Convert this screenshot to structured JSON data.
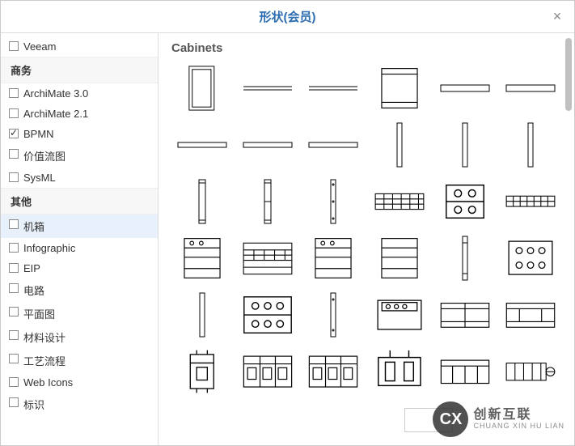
{
  "dialog": {
    "title": "形状(会员)"
  },
  "sidebar": {
    "top_item": {
      "label": "Veeam",
      "checked": false
    },
    "groups": [
      {
        "header": "商务",
        "items": [
          {
            "label": "ArchiMate 3.0",
            "checked": false
          },
          {
            "label": "ArchiMate 2.1",
            "checked": false
          },
          {
            "label": "BPMN",
            "checked": true
          },
          {
            "label": "价值流图",
            "checked": false
          },
          {
            "label": "SysML",
            "checked": false
          }
        ]
      },
      {
        "header": "其他",
        "items": [
          {
            "label": "机箱",
            "checked": false,
            "selected": true
          },
          {
            "label": "Infographic",
            "checked": false
          },
          {
            "label": "EIP",
            "checked": false
          },
          {
            "label": "电路",
            "checked": false
          },
          {
            "label": "平面图",
            "checked": false
          },
          {
            "label": "材料设计",
            "checked": false
          },
          {
            "label": "工艺流程",
            "checked": false
          },
          {
            "label": "Web Icons",
            "checked": false
          },
          {
            "label": "标识",
            "checked": false
          }
        ]
      }
    ]
  },
  "main": {
    "section_title": "Cabinets",
    "shape_count": 36
  },
  "watermark": {
    "cn": "创新互联",
    "en": "CHUANG XIN HU LIAN",
    "logo": "CX"
  }
}
